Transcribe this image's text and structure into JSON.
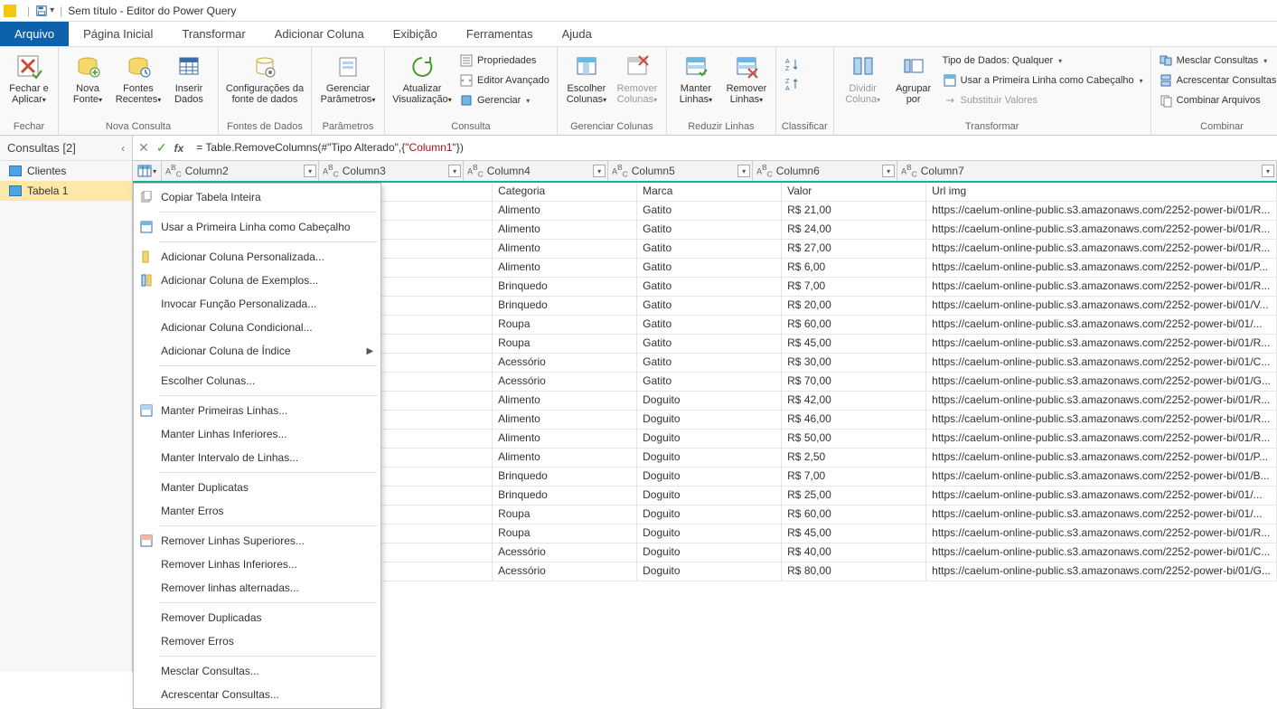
{
  "titlebar": {
    "title": "Sem título - Editor do Power Query"
  },
  "menutabs": {
    "arquivo": "Arquivo",
    "pagina": "Página Inicial",
    "transformar": "Transformar",
    "adicionar": "Adicionar Coluna",
    "exibicao": "Exibição",
    "ferramentas": "Ferramentas",
    "ajuda": "Ajuda"
  },
  "ribbon": {
    "fechar": {
      "fechar_aplicar": "Fechar e\nAplicar",
      "group": "Fechar"
    },
    "nova_consulta": {
      "nova_fonte": "Nova\nFonte",
      "fontes_recentes": "Fontes\nRecentes",
      "inserir_dados": "Inserir\nDados",
      "group": "Nova Consulta"
    },
    "fontes": {
      "config_fonte": "Configurações da\nfonte de dados",
      "group": "Fontes de Dados"
    },
    "parametros": {
      "gerenciar_param": "Gerenciar\nParâmetros",
      "group": "Parâmetros"
    },
    "consulta": {
      "atualizar": "Atualizar\nVisualização",
      "propriedades": "Propriedades",
      "editor_avancado": "Editor Avançado",
      "gerenciar": "Gerenciar",
      "group": "Consulta"
    },
    "gerenciar_col": {
      "escolher": "Escolher\nColunas",
      "remover": "Remover\nColunas",
      "group": "Gerenciar Colunas"
    },
    "reduzir": {
      "manter": "Manter\nLinhas",
      "remover": "Remover\nLinhas",
      "group": "Reduzir Linhas"
    },
    "classificar": {
      "group": "Classificar"
    },
    "transformar_top": {
      "dividir": "Dividir\nColuna",
      "agrupar": "Agrupar\npor",
      "tipo_dados": "Tipo de Dados: Qualquer",
      "primeira_linha": "Usar a Primeira Linha como Cabeçalho",
      "substituir": "Substituir Valores",
      "group": "Transformar"
    },
    "combinar": {
      "mesclar": "Mesclar Consultas",
      "acrescentar": "Acrescentar Consultas",
      "combinar_arq": "Combinar Arquivos",
      "group": "Combinar"
    }
  },
  "leftpanel": {
    "header": "Consultas [2]",
    "q1": "Clientes",
    "q2": "Tabela 1"
  },
  "formula": {
    "prefix": "= Table.RemoveColumns(#\"Tipo Alterado\",{",
    "str": "\"Column1\"",
    "suffix": "})"
  },
  "columns": {
    "c2": "Column2",
    "c3": "Column3",
    "c4": "Column4",
    "c5": "Column5",
    "c6": "Column6",
    "c7": "Column7",
    "abc": "ABC"
  },
  "rows": [
    {
      "c4": "Categoria",
      "c5": "Marca",
      "c6": "Valor",
      "c7": "Url img"
    },
    {
      "c4": "Alimento",
      "c5": "Gatito",
      "c6": "R$ 21,00",
      "c7": "https://caelum-online-public.s3.amazonaws.com/2252-power-bi/01/R..."
    },
    {
      "c4": "Alimento",
      "c5": "Gatito",
      "c6": "R$ 24,00",
      "c7": "https://caelum-online-public.s3.amazonaws.com/2252-power-bi/01/R..."
    },
    {
      "c4": "Alimento",
      "c5": "Gatito",
      "c6": "R$ 27,00",
      "c7": "https://caelum-online-public.s3.amazonaws.com/2252-power-bi/01/R..."
    },
    {
      "c4": "Alimento",
      "c5": "Gatito",
      "c6": "R$ 6,00",
      "c7": "https://caelum-online-public.s3.amazonaws.com/2252-power-bi/01/P..."
    },
    {
      "c4": "Brinquedo",
      "c5": "Gatito",
      "c6": "R$ 7,00",
      "c7": "https://caelum-online-public.s3.amazonaws.com/2252-power-bi/01/R..."
    },
    {
      "c4": "Brinquedo",
      "c5": "Gatito",
      "c6": "R$ 20,00",
      "c7": "https://caelum-online-public.s3.amazonaws.com/2252-power-bi/01/V..."
    },
    {
      "c4": "Roupa",
      "c5": "Gatito",
      "c6": "R$ 60,00",
      "c7": "https://caelum-online-public.s3.amazonaws.com/2252-power-bi/01/..."
    },
    {
      "c4": "Roupa",
      "c5": "Gatito",
      "c6": "R$ 45,00",
      "c7": "https://caelum-online-public.s3.amazonaws.com/2252-power-bi/01/R..."
    },
    {
      "c4": "Acessório",
      "c5": "Gatito",
      "c6": "R$ 30,00",
      "c7": "https://caelum-online-public.s3.amazonaws.com/2252-power-bi/01/C..."
    },
    {
      "c4": "Acessório",
      "c5": "Gatito",
      "c6": "R$ 70,00",
      "c7": "https://caelum-online-public.s3.amazonaws.com/2252-power-bi/01/G..."
    },
    {
      "c4": "Alimento",
      "c5": "Doguito",
      "c6": "R$ 42,00",
      "c7": "https://caelum-online-public.s3.amazonaws.com/2252-power-bi/01/R..."
    },
    {
      "c4": "Alimento",
      "c5": "Doguito",
      "c6": "R$ 46,00",
      "c7": "https://caelum-online-public.s3.amazonaws.com/2252-power-bi/01/R..."
    },
    {
      "c4": "Alimento",
      "c5": "Doguito",
      "c6": "R$ 50,00",
      "c7": "https://caelum-online-public.s3.amazonaws.com/2252-power-bi/01/R..."
    },
    {
      "c4": "Alimento",
      "c5": "Doguito",
      "c6": "R$ 2,50",
      "c7": "https://caelum-online-public.s3.amazonaws.com/2252-power-bi/01/P..."
    },
    {
      "c4": "Brinquedo",
      "c5": "Doguito",
      "c6": "R$ 7,00",
      "c7": "https://caelum-online-public.s3.amazonaws.com/2252-power-bi/01/B..."
    },
    {
      "c4": "Brinquedo",
      "c5": "Doguito",
      "c6": "R$ 25,00",
      "c7": "https://caelum-online-public.s3.amazonaws.com/2252-power-bi/01/..."
    },
    {
      "c4": "Roupa",
      "c5": "Doguito",
      "c6": "R$ 60,00",
      "c7": "https://caelum-online-public.s3.amazonaws.com/2252-power-bi/01/..."
    },
    {
      "c4": "Roupa",
      "c5": "Doguito",
      "c6": "R$ 45,00",
      "c7": "https://caelum-online-public.s3.amazonaws.com/2252-power-bi/01/R..."
    },
    {
      "c4": "Acessório",
      "c5": "Doguito",
      "c6": "R$ 40,00",
      "c7": "https://caelum-online-public.s3.amazonaws.com/2252-power-bi/01/C..."
    },
    {
      "c4": "Acessório",
      "c5": "Doguito",
      "c6": "R$ 80,00",
      "c7": "https://caelum-online-public.s3.amazonaws.com/2252-power-bi/01/G..."
    }
  ],
  "contextmenu": {
    "copiar": "Copiar Tabela Inteira",
    "usar_primeira": "Usar a Primeira Linha como Cabeçalho",
    "add_personalizada": "Adicionar Coluna Personalizada...",
    "add_exemplos": "Adicionar Coluna de Exemplos...",
    "invocar": "Invocar Função Personalizada...",
    "add_condicional": "Adicionar Coluna Condicional...",
    "add_indice": "Adicionar Coluna de Índice",
    "escolher": "Escolher Colunas...",
    "manter_primeiras": "Manter Primeiras Linhas...",
    "manter_inferiores": "Manter Linhas Inferiores...",
    "manter_intervalo": "Manter Intervalo de Linhas...",
    "manter_duplicatas": "Manter Duplicatas",
    "manter_erros": "Manter Erros",
    "remover_superiores": "Remover Linhas Superiores...",
    "remover_inferiores": "Remover Linhas Inferiores...",
    "remover_alternadas": "Remover linhas alternadas...",
    "remover_duplicadas": "Remover Duplicadas",
    "remover_erros": "Remover Erros",
    "mesclar": "Mesclar Consultas...",
    "acrescentar": "Acrescentar Consultas..."
  }
}
